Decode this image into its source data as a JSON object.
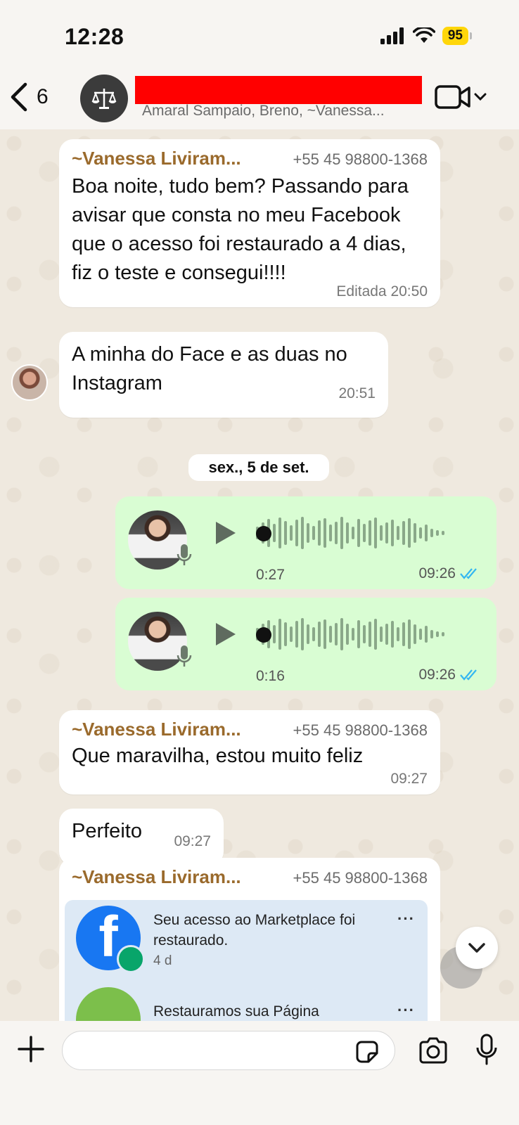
{
  "status_bar": {
    "time": "12:28",
    "battery": "95"
  },
  "header": {
    "back_count": "6",
    "subtitle": "Amaral Sampaio, Breno, ~Vanessa..."
  },
  "messages": [
    {
      "sender": "~Vanessa Liviram...",
      "phone": "+55 45 98800-1368",
      "text": "Boa noite, tudo bem? Passando para avisar que consta no meu Facebook que o acesso foi restaurado a 4 dias, fiz o teste e consegui!!!!",
      "meta": "Editada 20:50"
    },
    {
      "text": "A minha do Face e as duas no Instagram",
      "meta": "20:51"
    }
  ],
  "date_separator": "sex., 5 de set.",
  "voice_messages": [
    {
      "duration": "0:27",
      "time": "09:26"
    },
    {
      "duration": "0:16",
      "time": "09:26"
    }
  ],
  "messages2": [
    {
      "sender": "~Vanessa Liviram...",
      "phone": "+55 45 98800-1368",
      "text": "Que maravilha, estou muito feliz",
      "meta": "09:27"
    },
    {
      "text": "Perfeito",
      "meta": "09:27"
    },
    {
      "sender": "~Vanessa Liviram...",
      "phone": "+55 45 98800-1368"
    }
  ],
  "fb_card": {
    "item1_title": "Seu acesso ao Marketplace foi restaurado.",
    "item1_time": "4 d",
    "item1_more": "···",
    "item2_title": "Restauramos sua Página",
    "item2_more": "···",
    "logo_letter": "f"
  },
  "colors": {
    "outgoing": "#d9fdd3",
    "incoming": "#ffffff",
    "sender": "#9a6a2c",
    "read_ticks": "#34b7f1",
    "facebook": "#1877f2"
  }
}
